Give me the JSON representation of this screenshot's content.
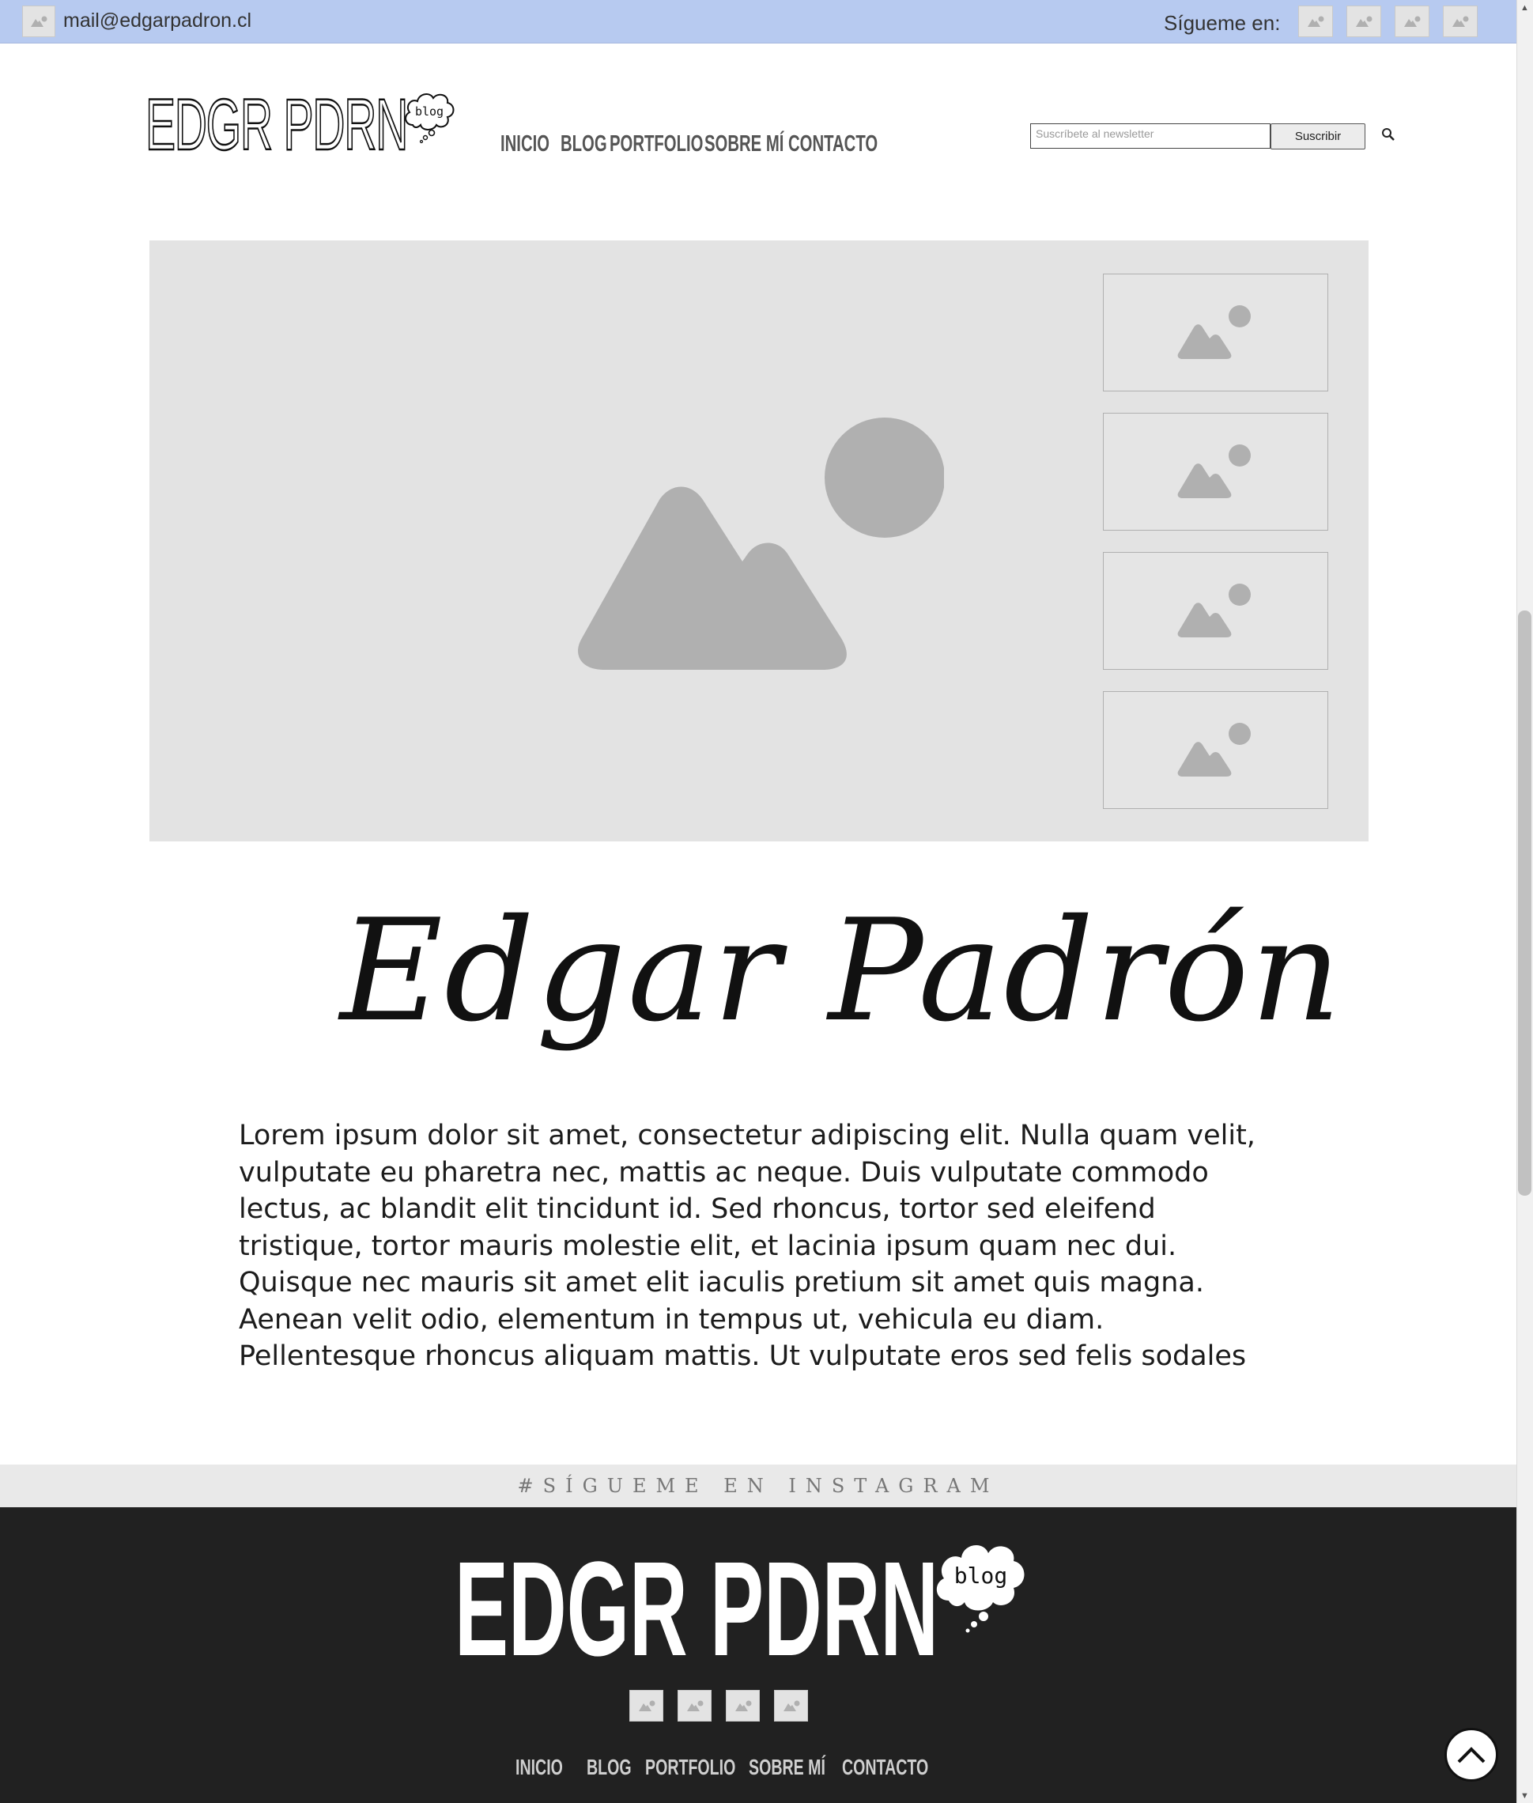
{
  "topbar": {
    "email": "mail@edgarpadron.cl",
    "follow_label": "Sígueme en:",
    "social_icons": [
      "image-placeholder-icon",
      "image-placeholder-icon",
      "image-placeholder-icon",
      "image-placeholder-icon"
    ]
  },
  "header": {
    "logo_text": "EDGR PDRN",
    "logo_bubble": "blog",
    "nav": [
      "INICIO",
      "BLOG",
      "PORTFOLIO",
      "SOBRE MÍ",
      "CONTACTO"
    ],
    "newsletter_placeholder": "Suscríbete al newsletter",
    "subscribe_label": "Suscribir",
    "search_icon": "search-icon"
  },
  "slider": {
    "main_image": "image-placeholder-icon",
    "thumbnails": [
      "image-placeholder-icon",
      "image-placeholder-icon",
      "image-placeholder-icon",
      "image-placeholder-icon"
    ]
  },
  "about": {
    "signature": "Edgar Padrón",
    "text": "Lorem ipsum dolor sit amet, consectetur adipiscing elit. Nulla quam velit, vulputate eu pharetra nec, mattis ac neque. Duis vulputate commodo lectus, ac blandit elit tincidunt id. Sed rhoncus, tortor sed eleifend tristique, tortor mauris molestie elit, et lacinia ipsum quam nec dui. Quisque nec mauris sit amet elit iaculis pretium sit amet quis magna. Aenean velit odio, elementum in tempus ut, vehicula eu diam. Pellentesque rhoncus aliquam mattis. Ut vulputate eros sed felis sodales"
  },
  "instagram": {
    "label": "#SÍGUEME EN INSTAGRAM"
  },
  "footer": {
    "logo_text": "EDGR PDRN",
    "logo_bubble": "blog",
    "social_icons": [
      "image-placeholder-icon",
      "image-placeholder-icon",
      "image-placeholder-icon",
      "image-placeholder-icon"
    ],
    "nav": [
      "INICIO",
      "BLOG",
      "PORTFOLIO",
      "SOBRE MÍ",
      "CONTACTO"
    ]
  },
  "colors": {
    "topbar_bg": "#b7caf0",
    "placeholder_bg": "#e3e3e3",
    "placeholder_shape": "#b0b0b0",
    "footer_bg": "#212121",
    "instagram_bar_bg": "#e9e9e9"
  },
  "controls": {
    "back_to_top_icon": "chevron-up-icon"
  }
}
